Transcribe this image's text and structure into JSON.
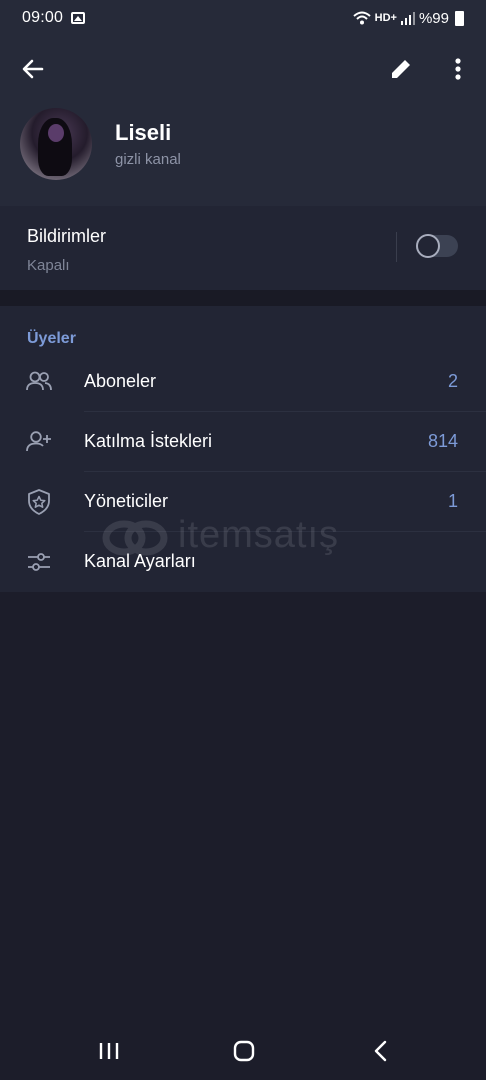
{
  "status_bar": {
    "time": "09:00",
    "network": "HD+",
    "battery": "%99"
  },
  "header": {
    "channel_name": "Liseli",
    "channel_type": "gizli kanal"
  },
  "notifications": {
    "title": "Bildirimler",
    "state": "Kapalı",
    "enabled": false
  },
  "members": {
    "section_title": "Üyeler",
    "rows": [
      {
        "label": "Aboneler",
        "count": "2",
        "icon": "people-icon"
      },
      {
        "label": "Katılma İstekleri",
        "count": "814",
        "icon": "add-user-icon"
      },
      {
        "label": "Yöneticiler",
        "count": "1",
        "icon": "shield-star-icon"
      },
      {
        "label": "Kanal Ayarları",
        "count": "",
        "icon": "sliders-icon"
      }
    ]
  },
  "watermark": {
    "text": "itemsatış"
  },
  "colors": {
    "accent": "#7d9bd8",
    "header_bg": "#262a39",
    "section_bg": "#222534",
    "page_bg": "#1c1d2a"
  }
}
